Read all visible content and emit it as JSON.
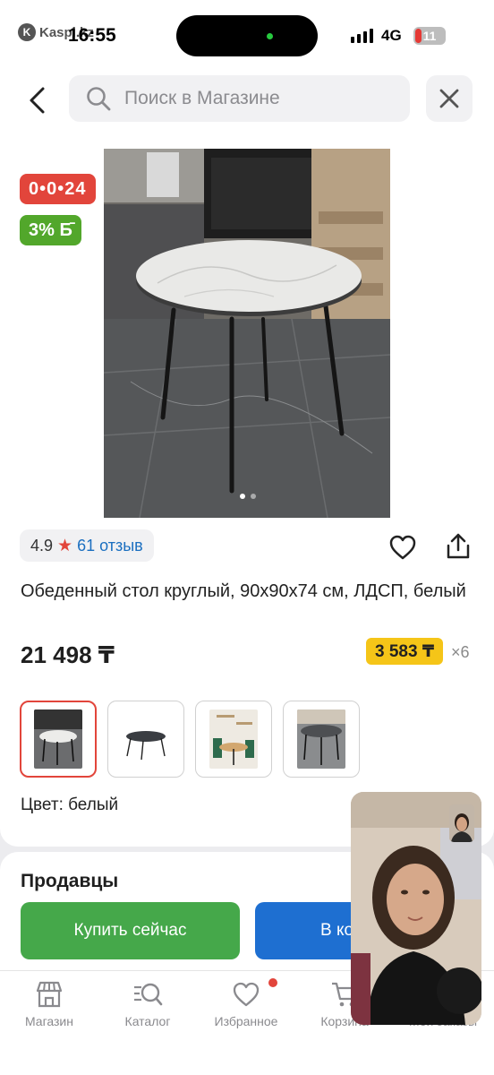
{
  "status_bar": {
    "app_name": "Kaspi.kz",
    "time": "16:55",
    "network": "4G",
    "battery": "11"
  },
  "search": {
    "placeholder": "Поиск в Магазине"
  },
  "product": {
    "timer_badge": "0•0•24",
    "bonus_badge": "3% Б̄",
    "photo_count": 2,
    "photo_active": 1,
    "rating": "4.9",
    "reviews": "61 отзыв",
    "title": "Обеденный стол круглый, 90x90x74 см, ЛДСП, белый",
    "price": "21 498 ₸",
    "installment_price": "3 583 ₸",
    "installment_months": "×6",
    "color_label": "Цвет: белый",
    "thumbnails": [
      {
        "name": "thumb-white-table-kitchen",
        "selected": true
      },
      {
        "name": "thumb-dark-table-product",
        "selected": false
      },
      {
        "name": "thumb-table-room",
        "selected": false
      },
      {
        "name": "thumb-grey-table-floor",
        "selected": false
      }
    ]
  },
  "sellers": {
    "heading": "Продавцы",
    "buy_now": "Купить сейчас",
    "add_to_cart": "В корзину"
  },
  "bottom_nav": {
    "items": [
      {
        "label": "Магазин",
        "icon": "shop-icon"
      },
      {
        "label": "Каталог",
        "icon": "catalog-search-icon"
      },
      {
        "label": "Избранное",
        "icon": "heart-icon"
      },
      {
        "label": "Корзина",
        "icon": "cart-icon"
      },
      {
        "label": "Мои заказы",
        "icon": "orders-icon"
      }
    ]
  },
  "colors": {
    "accent_red": "#e2453b",
    "bonus_green": "#52a72b",
    "buy_green": "#45a84a",
    "cart_blue": "#1e6fd1",
    "installment_yellow": "#f5c518",
    "link_blue": "#1b6fc0"
  }
}
